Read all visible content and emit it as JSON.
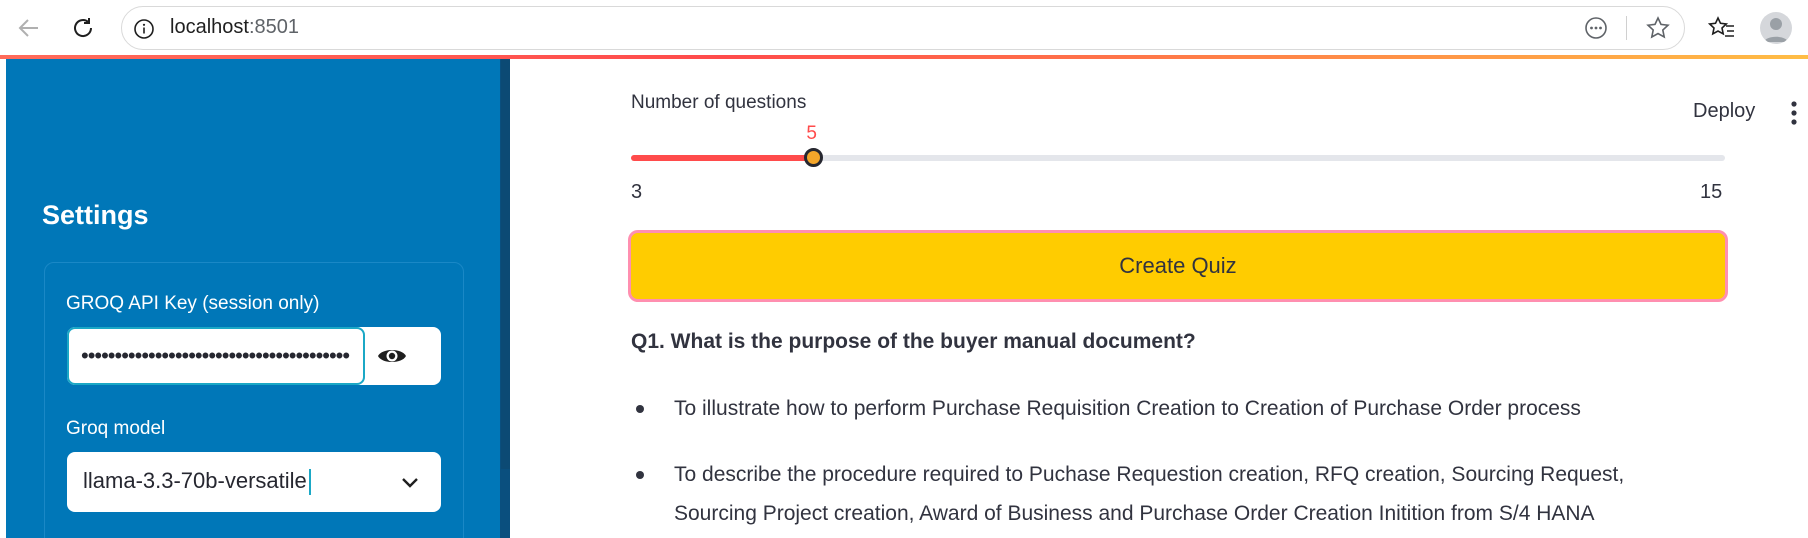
{
  "browser": {
    "url_host": "localhost",
    "url_port": ":8501"
  },
  "sidebar": {
    "title": "Settings",
    "api_key_label": "GROQ API Key (session only)",
    "api_key_value": "••••••••••••••••••••••••••••••••••••••••",
    "model_label": "Groq model",
    "model_value": "llama-3.3-70b-versatile"
  },
  "main": {
    "deploy_label": "Deploy",
    "slider": {
      "label": "Number of questions",
      "value": "5",
      "min": "3",
      "max": "15",
      "fraction": 0.1667
    },
    "create_button": "Create Quiz",
    "question": "Q1. What is the purpose of the buyer manual document?",
    "options": [
      "To illustrate how to perform Purchase Requisition Creation to Creation of Purchase Order process",
      "To describe the procedure required to Puchase Requestion creation, RFQ creation, Sourcing Request,",
      "Sourcing Project creation, Award of Business and Purchase Order Creation Initition from S/4 HANA"
    ]
  },
  "colors": {
    "sidebar_bg": "#0077b8",
    "slider_accent": "#ff4b4b",
    "button_bg": "#ffcc00",
    "button_border": "#ff8fb0"
  }
}
